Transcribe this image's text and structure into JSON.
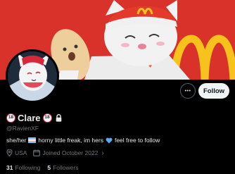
{
  "profile": {
    "display_name": "Clare",
    "age_badge": "18",
    "handle": "@RavienXF",
    "bio_before_flag": "she/her",
    "bio_middle": "horny little freak, im hers",
    "bio_end": "feel free to follow",
    "location": "USA",
    "joined": "Joined October 2022",
    "following_count": "31",
    "following_label": "Following",
    "followers_count": "5",
    "followers_label": "Followers",
    "protected": true
  },
  "actions": {
    "more_label": "•••",
    "follow_label": "Follow"
  },
  "icons": {
    "age": "age-18-badge-icon",
    "lock": "lock-icon",
    "flag": "transgender-flag-icon",
    "heart": "blue-heart-icon",
    "location": "location-pin-icon",
    "calendar": "calendar-icon",
    "chevron": "chevron-right-icon"
  },
  "colors": {
    "banner_red": "#d8322b",
    "follow_bg": "#eff3f4",
    "secondary_text": "#71767b",
    "primary_text": "#e7e9ea",
    "heart_blue": "#5aaaf0"
  }
}
